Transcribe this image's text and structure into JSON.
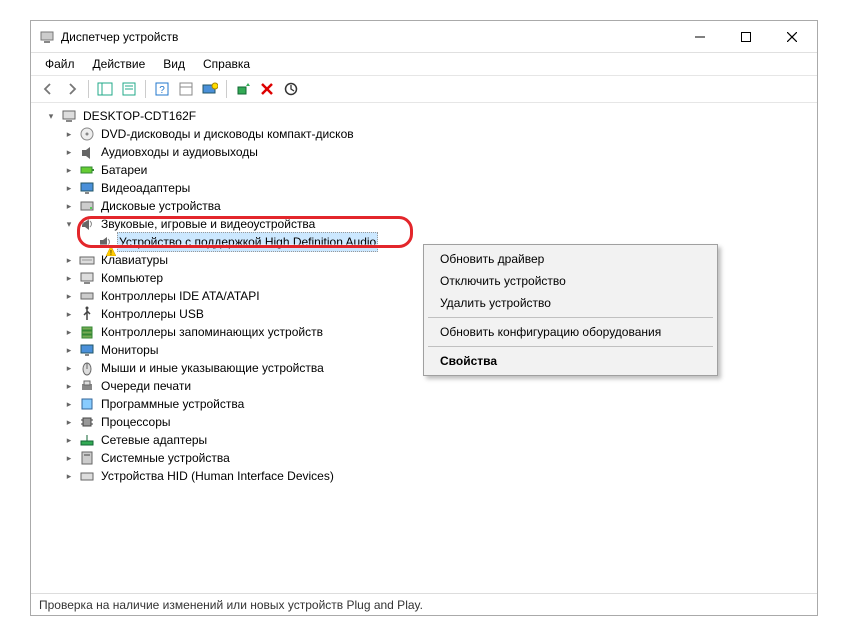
{
  "window": {
    "title": "Диспетчер устройств"
  },
  "menu": {
    "file": "Файл",
    "action": "Действие",
    "view": "Вид",
    "help": "Справка"
  },
  "tree": {
    "root": "DESKTOP-CDT162F",
    "items": [
      "DVD-дисководы и дисководы компакт-дисков",
      "Аудиовходы и аудиовыходы",
      "Батареи",
      "Видеоадаптеры",
      "Дисковые устройства"
    ],
    "sound_category": "Звуковые, игровые и видеоустройства",
    "selected_device": "Устройство с поддержкой High Definition Audio",
    "items2": [
      "Клавиатуры",
      "Компьютер",
      "Контроллеры IDE ATA/ATAPI",
      "Контроллеры USB",
      "Контроллеры запоминающих устройств",
      "Мониторы",
      "Мыши и иные указывающие устройства",
      "Очереди печати",
      "Программные устройства",
      "Процессоры",
      "Сетевые адаптеры",
      "Системные устройства",
      "Устройства HID (Human Interface Devices)"
    ]
  },
  "context_menu": {
    "update_driver": "Обновить драйвер",
    "disable_device": "Отключить устройство",
    "delete_device": "Удалить устройство",
    "scan_hardware": "Обновить конфигурацию оборудования",
    "properties": "Свойства"
  },
  "status": "Проверка на наличие изменений или новых устройств Plug and Play."
}
